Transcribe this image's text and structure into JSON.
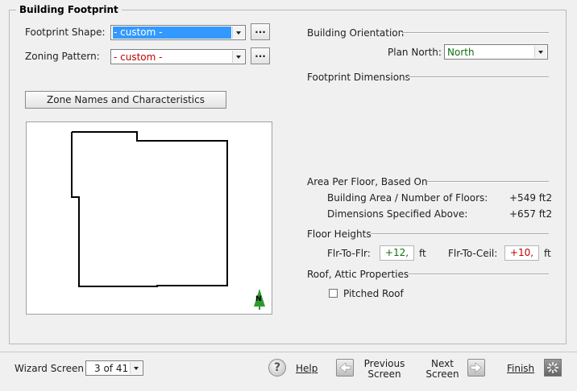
{
  "group_title": "Building Footprint",
  "left": {
    "footprint_shape_label": "Footprint Shape:",
    "footprint_shape_value": "- custom -",
    "zoning_pattern_label": "Zoning Pattern:",
    "zoning_pattern_value": "- custom -",
    "ellipsis": "...",
    "zone_button": "Zone Names and Characteristics",
    "north_marker": "N"
  },
  "right": {
    "building_orientation": "Building Orientation",
    "plan_north_label": "Plan North:",
    "plan_north_value": "North",
    "footprint_dimensions": "Footprint Dimensions",
    "area_per_floor": "Area Per Floor, Based On",
    "building_area_label": "Building Area / Number of Floors:",
    "building_area_value": "+549 ft2",
    "dimensions_label": "Dimensions Specified Above:",
    "dimensions_value": "+657 ft2",
    "floor_heights": "Floor Heights",
    "flr_to_flr_label": "Flr-To-Flr:",
    "flr_to_flr_value": "+12,",
    "ft_unit": "ft",
    "flr_to_ceil_label": "Flr-To-Ceil:",
    "flr_to_ceil_value": "+10,",
    "roof_attic": "Roof, Attic Properties",
    "pitched_roof": "Pitched Roof"
  },
  "bottom": {
    "wizard_screen_label": "Wizard Screen",
    "wizard_screen_value": "3 of 41",
    "help": "Help",
    "previous_line1": "Previous",
    "previous_line2": "Screen",
    "next_line1": "Next",
    "next_line2": "Screen",
    "finish": "Finish"
  },
  "colors": {
    "selection": "#3399ff",
    "invalid_text": "#c00000",
    "valid_text": "#107010"
  }
}
